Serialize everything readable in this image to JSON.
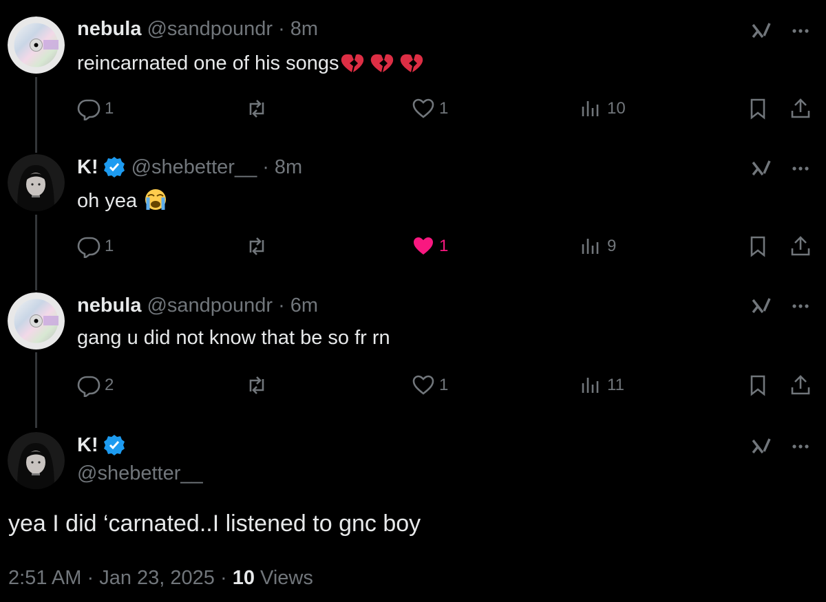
{
  "colors": {
    "background": "#000000",
    "text": "#e7e9ea",
    "muted": "#71767b",
    "like": "#f91880",
    "verified": "#1d9bf0",
    "thread": "#333639"
  },
  "posts": [
    {
      "name": "nebula",
      "handle": "@sandpoundr",
      "sep": "·",
      "time": "8m",
      "text": "reincarnated one of his songs",
      "emoji": "broken-heart x3",
      "verified": false,
      "replies": "1",
      "reposts": "",
      "likes": "1",
      "liked": false,
      "views": "10"
    },
    {
      "name": "K!",
      "handle": "@shebetter__",
      "sep": "·",
      "time": "8m",
      "text": "oh yea",
      "emoji": "loudly-crying-face",
      "verified": true,
      "replies": "1",
      "reposts": "",
      "likes": "1",
      "liked": true,
      "views": "9"
    },
    {
      "name": "nebula",
      "handle": "@sandpoundr",
      "sep": "·",
      "time": "6m",
      "text": "gang u did not know that be so fr rn",
      "emoji": "",
      "verified": false,
      "replies": "2",
      "reposts": "",
      "likes": "1",
      "liked": false,
      "views": "11"
    }
  ],
  "main_post": {
    "name": "K!",
    "handle": "@shebetter__",
    "verified": true,
    "text": "yea I did ‘carnated..I listened to gnc boy",
    "time": "2:51 AM",
    "sep1": "·",
    "date": "Jan 23, 2025",
    "sep2": "·",
    "views_count": "10",
    "views_label": "Views"
  },
  "icons": {
    "reply": "reply-icon",
    "repost": "repost-icon",
    "like": "heart-icon",
    "views": "views-icon",
    "bookmark": "bookmark-icon",
    "share": "share-icon",
    "grok": "grok-icon",
    "more": "more-icon"
  }
}
